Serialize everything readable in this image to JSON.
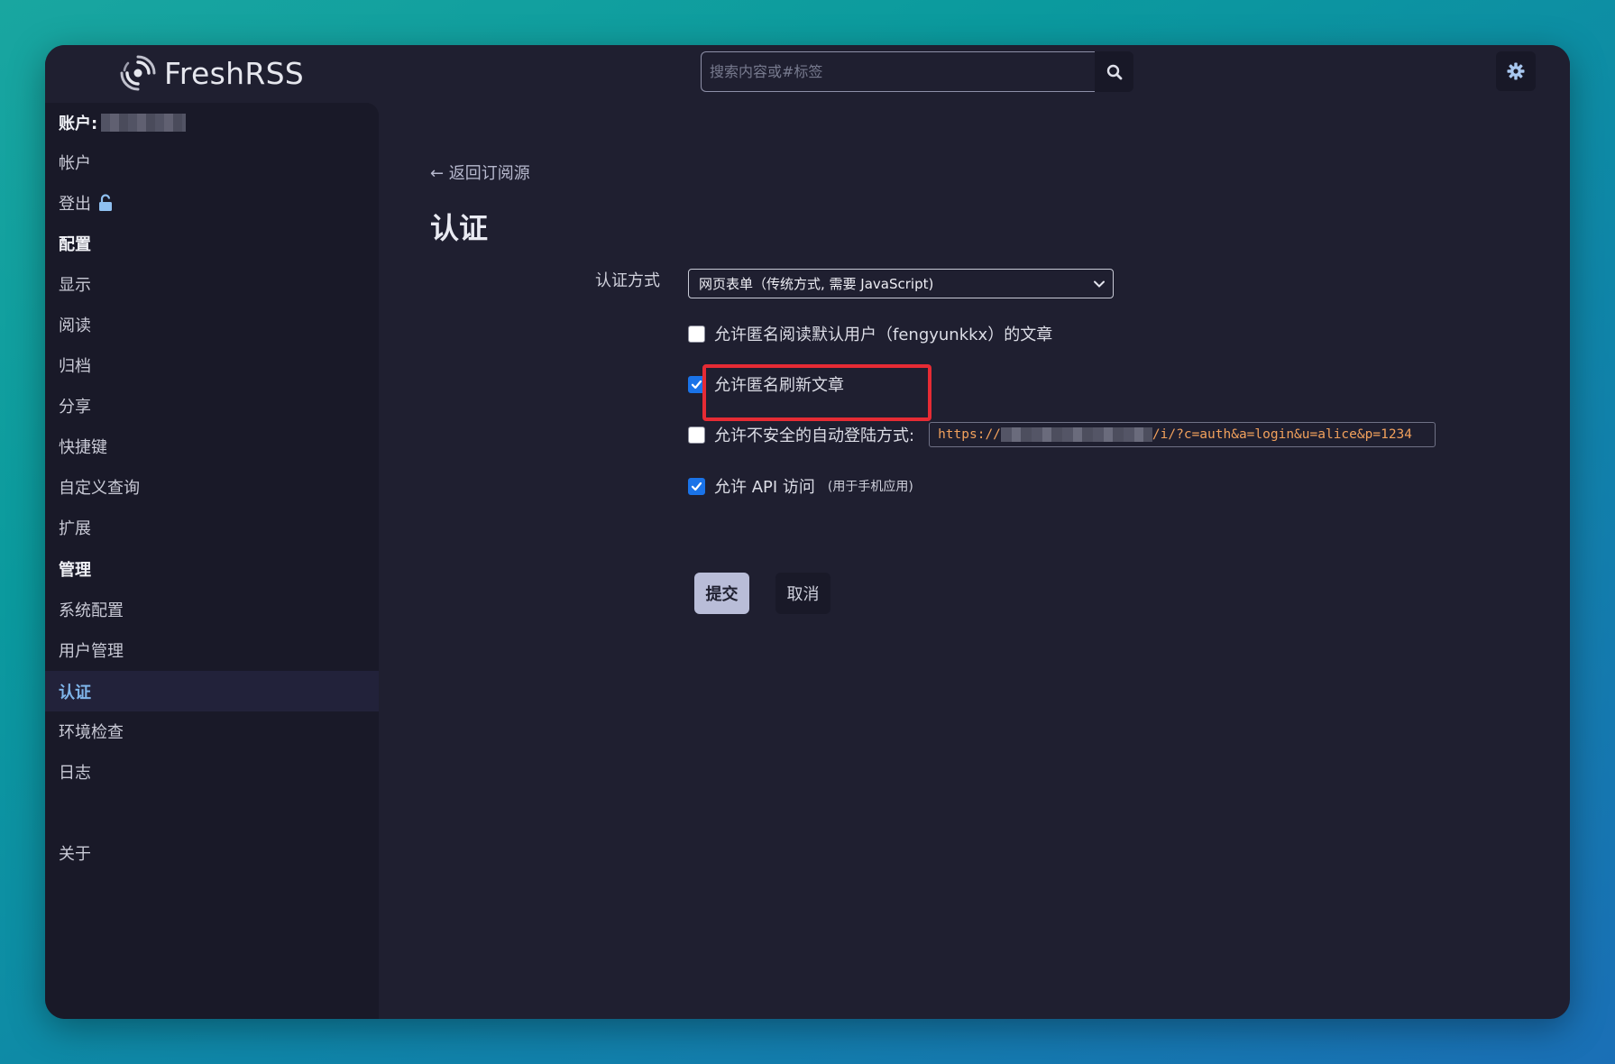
{
  "app": {
    "name": "FreshRSS"
  },
  "search": {
    "placeholder": "搜索内容或#标签"
  },
  "icons": {
    "logo": "freshrss-logo-icon",
    "search": "search-icon",
    "settings": "gear-icon",
    "lock": "lock-icon",
    "caret": "chevron-down-icon"
  },
  "sidebar": {
    "account_label": "账户:",
    "items": [
      {
        "type": "head",
        "label": "账户:"
      },
      {
        "type": "item",
        "label": "帐户"
      },
      {
        "type": "item",
        "label": "登出"
      },
      {
        "type": "head",
        "label": "配置"
      },
      {
        "type": "item",
        "label": "显示"
      },
      {
        "type": "item",
        "label": "阅读"
      },
      {
        "type": "item",
        "label": "归档"
      },
      {
        "type": "item",
        "label": "分享"
      },
      {
        "type": "item",
        "label": "快捷键"
      },
      {
        "type": "item",
        "label": "自定义查询"
      },
      {
        "type": "item",
        "label": "扩展"
      },
      {
        "type": "head",
        "label": "管理"
      },
      {
        "type": "item",
        "label": "系统配置"
      },
      {
        "type": "item",
        "label": "用户管理"
      },
      {
        "type": "item",
        "label": "认证",
        "active": true
      },
      {
        "type": "item",
        "label": "环境检查"
      },
      {
        "type": "item",
        "label": "日志"
      },
      {
        "type": "item",
        "label": "关于"
      }
    ]
  },
  "main": {
    "back_link": "← 返回订阅源",
    "title": "认证",
    "auth_method_label": "认证方式",
    "auth_method_value": "网页表单（传统方式, 需要 JavaScript)",
    "options": [
      {
        "label": "允许匿名阅读默认用户（fengyunkkx）的文章",
        "checked": false
      },
      {
        "label": "允许匿名刷新文章",
        "checked": true
      },
      {
        "label": "允许不安全的自动登陆方式:",
        "checked": false
      },
      {
        "label": "允许 API 访问",
        "note": "(用于手机应用)",
        "checked": true
      }
    ],
    "auto_login_url_prefix": "https://",
    "auto_login_url_suffix": "/i/?c=auth&a=login&u=alice&p=1234",
    "submit_label": "提交",
    "cancel_label": "取消"
  },
  "colors": {
    "accent_active": "#7fb5ea",
    "highlight_border": "#e62b34",
    "checkbox_checked": "#1a73e8",
    "url_text": "#f2a15c"
  }
}
